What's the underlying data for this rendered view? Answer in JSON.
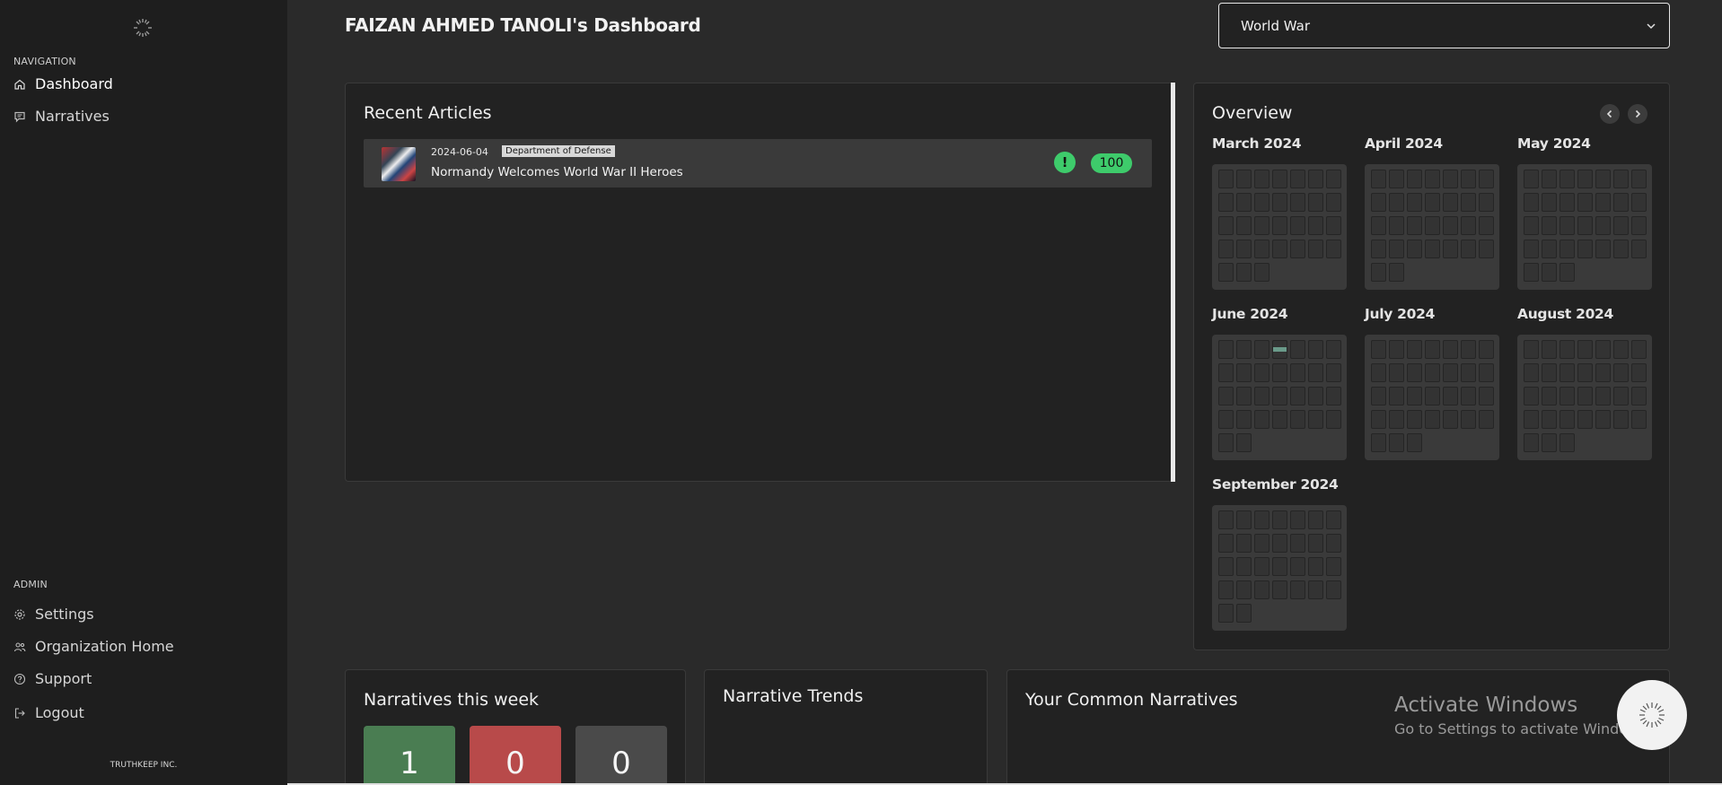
{
  "sidebar": {
    "navigation_label": "NAVIGATION",
    "nav_items": [
      {
        "label": "Dashboard",
        "icon": "home-icon"
      },
      {
        "label": "Narratives",
        "icon": "message-icon"
      }
    ],
    "admin_label": "ADMIN",
    "admin_items": [
      {
        "label": "Settings",
        "icon": "gear-icon"
      },
      {
        "label": "Organization Home",
        "icon": "users-icon"
      },
      {
        "label": "Support",
        "icon": "help-circle-icon"
      },
      {
        "label": "Logout",
        "icon": "logout-icon"
      }
    ],
    "footer": "TRUTHKEEP INC."
  },
  "header": {
    "title": "FAIZAN AHMED TANOLI's Dashboard",
    "topic_select_value": "World War"
  },
  "recent_articles": {
    "title": "Recent Articles",
    "items": [
      {
        "date": "2024-06-04",
        "source": "Department of Defense",
        "title": "Normandy Welcomes World War II Heroes",
        "alert_icon": "!",
        "score": "100"
      }
    ]
  },
  "overview": {
    "title": "Overview",
    "months": [
      {
        "label": "March 2024",
        "days": 31,
        "start_col": 0
      },
      {
        "label": "April 2024",
        "days": 30,
        "start_col": 0
      },
      {
        "label": "May 2024",
        "days": 31,
        "start_col": 0
      },
      {
        "label": "June 2024",
        "days": 30,
        "start_col": 0,
        "active_days": [
          4
        ]
      },
      {
        "label": "July 2024",
        "days": 31,
        "start_col": 0
      },
      {
        "label": "August 2024",
        "days": 31,
        "start_col": 0
      },
      {
        "label": "September 2024",
        "days": 30,
        "start_col": 0
      }
    ],
    "cell_color": "#333333",
    "active_color": "#6a9a8a"
  },
  "narratives_week": {
    "title": "Narratives this week",
    "counts": [
      {
        "value": "1",
        "color": "#4a7d52"
      },
      {
        "value": "0",
        "color": "#b84a4a"
      },
      {
        "value": "0",
        "color": "#4a4a4a"
      }
    ]
  },
  "narrative_trends": {
    "title": "Narrative Trends"
  },
  "common_narratives": {
    "title": "Your Common Narratives"
  },
  "windows_watermark": {
    "line1": "Activate Windows",
    "line2": "Go to Settings to activate Windows."
  }
}
